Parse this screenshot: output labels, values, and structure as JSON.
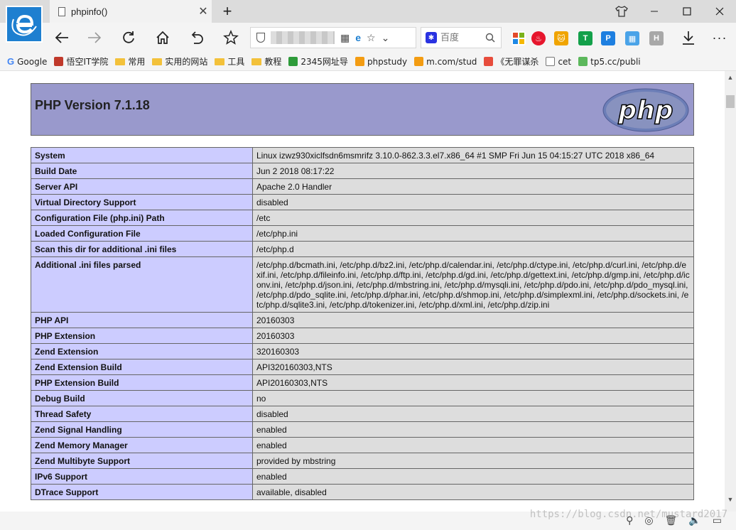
{
  "browser": {
    "tab_title": "phpinfo()",
    "new_tab_symbol": "+",
    "close_symbol": "✕",
    "search_placeholder": "百度",
    "search_engine_icon": "baidu-paw-icon",
    "window_controls": [
      "minimize",
      "maximize",
      "close"
    ],
    "extensions": [
      {
        "name": "office-icon",
        "color": "#e34a2a"
      },
      {
        "name": "weibo-icon",
        "color": "#e6162d"
      },
      {
        "name": "tmall-cat-icon",
        "color": "#f0a400"
      },
      {
        "name": "shield-t-icon",
        "color": "#13a04a",
        "text": "T"
      },
      {
        "name": "p-icon",
        "color": "#1e7fe0",
        "text": "P"
      },
      {
        "name": "grid-icon",
        "color": "#4aa3e8"
      },
      {
        "name": "h-icon",
        "color": "#a8a8a8",
        "text": "H"
      }
    ]
  },
  "bookmarks": [
    {
      "label": "Google",
      "icon": "google-icon"
    },
    {
      "label": "悟空IT学院",
      "icon": "avatar-icon"
    },
    {
      "label": "常用",
      "icon": "folder-icon"
    },
    {
      "label": "实用的网站",
      "icon": "folder-icon"
    },
    {
      "label": "工具",
      "icon": "folder-icon"
    },
    {
      "label": "教程",
      "icon": "folder-icon"
    },
    {
      "label": "2345网址导",
      "icon": "2345-icon"
    },
    {
      "label": "phpstudy",
      "icon": "pma-icon"
    },
    {
      "label": "m.com/stud",
      "icon": "pma-icon"
    },
    {
      "label": "《无罪谋杀",
      "icon": "listen-icon"
    },
    {
      "label": "cet",
      "icon": "page-icon"
    },
    {
      "label": "tp5.cc/publi",
      "icon": "leaf-icon"
    }
  ],
  "page": {
    "title": "PHP Version 7.1.18",
    "logo_text": "php",
    "rows": [
      {
        "key": "System",
        "value": "Linux izwz930xiclfsdn6msmrifz 3.10.0-862.3.3.el7.x86_64 #1 SMP Fri Jun 15 04:15:27 UTC 2018 x86_64"
      },
      {
        "key": "Build Date",
        "value": "Jun 2 2018 08:17:22"
      },
      {
        "key": "Server API",
        "value": "Apache 2.0 Handler"
      },
      {
        "key": "Virtual Directory Support",
        "value": "disabled"
      },
      {
        "key": "Configuration File (php.ini) Path",
        "value": "/etc"
      },
      {
        "key": "Loaded Configuration File",
        "value": "/etc/php.ini"
      },
      {
        "key": "Scan this dir for additional .ini files",
        "value": "/etc/php.d"
      },
      {
        "key": "Additional .ini files parsed",
        "value": "/etc/php.d/bcmath.ini, /etc/php.d/bz2.ini, /etc/php.d/calendar.ini, /etc/php.d/ctype.ini, /etc/php.d/curl.ini, /etc/php.d/exif.ini, /etc/php.d/fileinfo.ini, /etc/php.d/ftp.ini, /etc/php.d/gd.ini, /etc/php.d/gettext.ini, /etc/php.d/gmp.ini, /etc/php.d/iconv.ini, /etc/php.d/json.ini, /etc/php.d/mbstring.ini, /etc/php.d/mysqli.ini, /etc/php.d/pdo.ini, /etc/php.d/pdo_mysql.ini, /etc/php.d/pdo_sqlite.ini, /etc/php.d/phar.ini, /etc/php.d/shmop.ini, /etc/php.d/simplexml.ini, /etc/php.d/sockets.ini, /etc/php.d/sqlite3.ini, /etc/php.d/tokenizer.ini, /etc/php.d/xml.ini, /etc/php.d/zip.ini"
      },
      {
        "key": "PHP API",
        "value": "20160303"
      },
      {
        "key": "PHP Extension",
        "value": "20160303"
      },
      {
        "key": "Zend Extension",
        "value": "320160303"
      },
      {
        "key": "Zend Extension Build",
        "value": "API320160303,NTS"
      },
      {
        "key": "PHP Extension Build",
        "value": "API20160303,NTS"
      },
      {
        "key": "Debug Build",
        "value": "no"
      },
      {
        "key": "Thread Safety",
        "value": "disabled"
      },
      {
        "key": "Zend Signal Handling",
        "value": "enabled"
      },
      {
        "key": "Zend Memory Manager",
        "value": "enabled"
      },
      {
        "key": "Zend Multibyte Support",
        "value": "provided by mbstring"
      },
      {
        "key": "IPv6 Support",
        "value": "enabled"
      },
      {
        "key": "DTrace Support",
        "value": "available, disabled"
      }
    ]
  },
  "watermark": "https://blog.csdn.net/mustard2017",
  "colors": {
    "header_bg": "#9999cc",
    "key_bg": "#ccccff",
    "value_bg": "#dddddd",
    "browser_accent": "#1e7fd0"
  }
}
